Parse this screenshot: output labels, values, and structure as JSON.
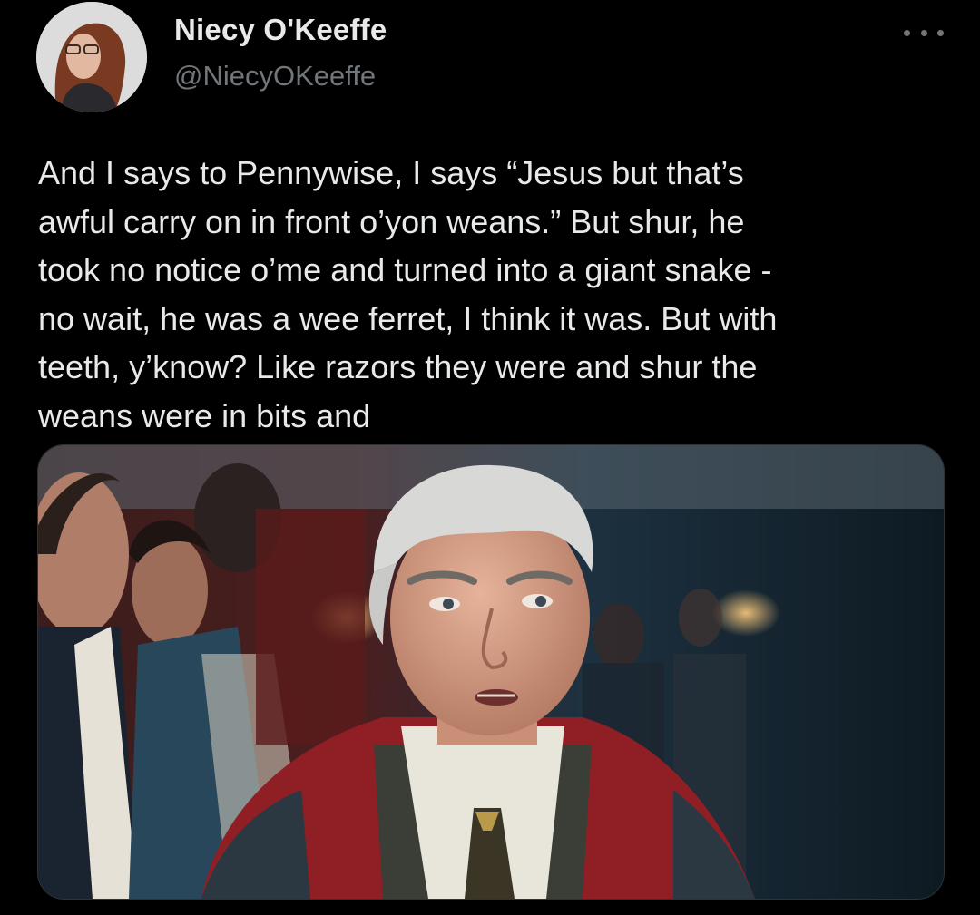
{
  "tweet": {
    "author": {
      "display_name": "Niecy O'Keeffe",
      "handle": "@NiecyOKeeffe",
      "avatar_icon": "profile-photo"
    },
    "more_icon": "more-horizontal-icon",
    "text": "And I says to Pennywise, I says “Jesus but that’s\nawful carry on in front o’yon weans.” But shur, he\ntook no notice o’me and turned into a giant snake -\nno wait, he was a wee ferret, I think it was. But with\nteeth, y’know? Like razors they were and shur the\nweans were in bits and",
    "media": {
      "kind": "photo"
    }
  },
  "colors": {
    "background": "#000000",
    "primary_text": "#e7e9ea",
    "secondary_text": "#71767b",
    "media_border": "#2f3336"
  }
}
